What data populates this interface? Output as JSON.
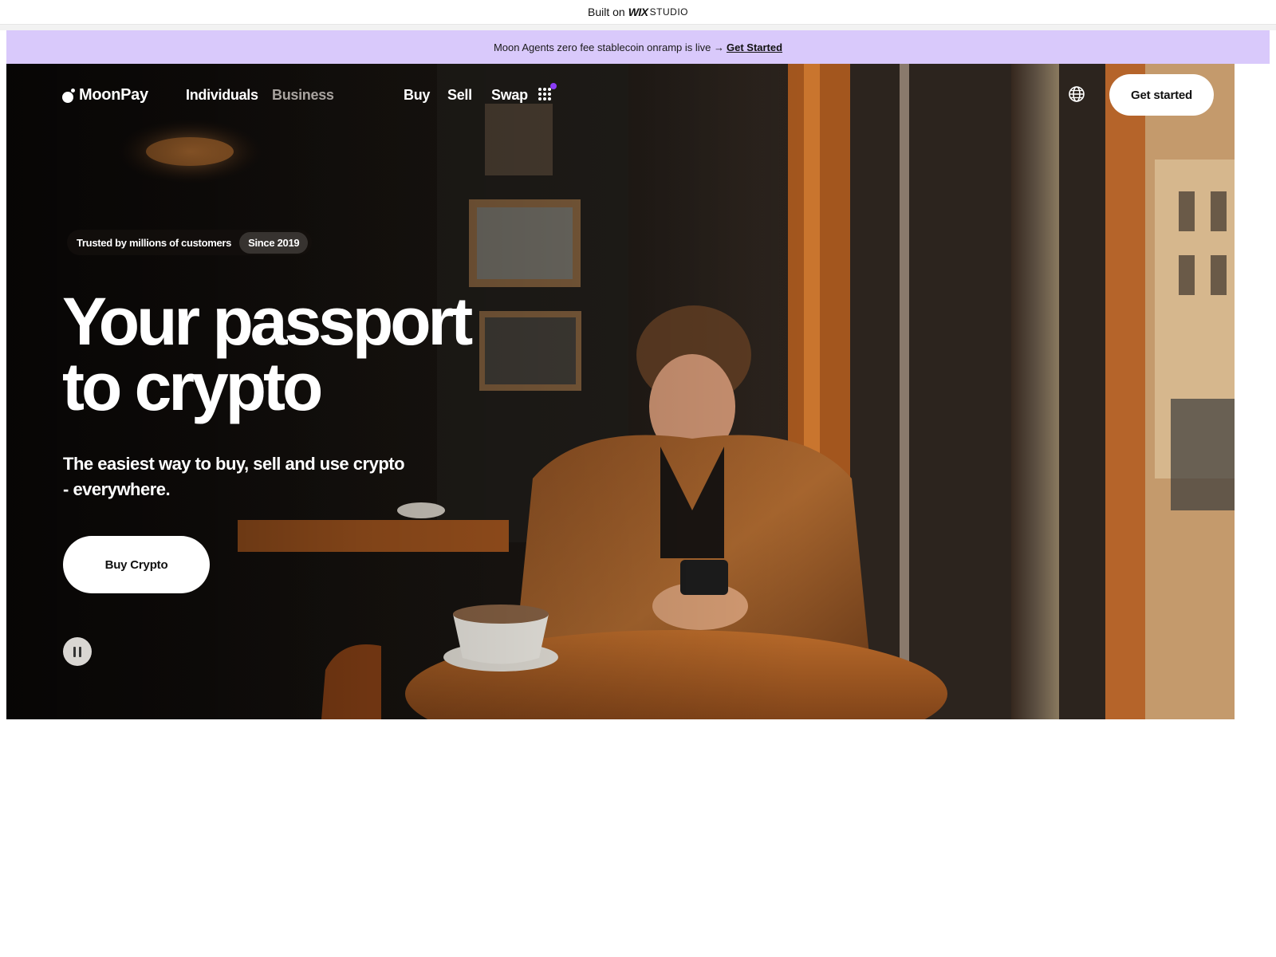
{
  "wix_bar": {
    "prefix": "Built on",
    "brand_bold": "WIX",
    "brand_light": "STUDIO"
  },
  "announcement": {
    "text": "Moon Agents zero fee stablecoin onramp is live →",
    "link": "Get Started"
  },
  "nav": {
    "logo": "MoonPay",
    "audience_tabs": [
      "Individuals",
      "Business"
    ],
    "menu_items": [
      "Buy",
      "Sell",
      "Swap"
    ],
    "apps_icon": "grid-dots-icon",
    "globe_icon": "globe-icon",
    "cta": "Get started"
  },
  "hero": {
    "trust_text": "Trusted by millions of customers",
    "trust_badge": "Since 2019",
    "headline_line1": "Your passport",
    "headline_line2": "to crypto",
    "subheadline": "The easiest way to buy, sell and use crypto - everywhere.",
    "primary_button": "Buy Crypto",
    "pause_icon": "pause-icon"
  },
  "colors": {
    "announcement_bg": "#d9c9fb",
    "notification_dot": "#8b3cf7",
    "button_bg": "#ffffff"
  }
}
